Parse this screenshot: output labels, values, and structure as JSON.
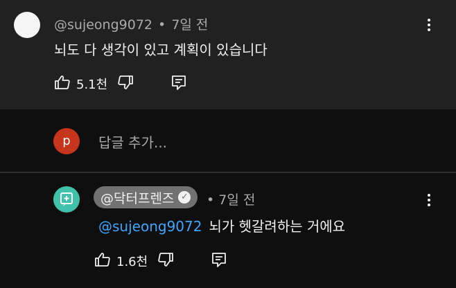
{
  "comment": {
    "author": "@sujeong9072",
    "separator": "•",
    "time": "7일 전",
    "text": "뇌도 다 생각이 있고 계획이 있습니다",
    "like_count": "5.1천"
  },
  "reply_box": {
    "avatar_letter": "p",
    "placeholder": "답글 추가..."
  },
  "reply": {
    "author": "@닥터프렌즈",
    "time": "7일 전",
    "mention": "@sujeong9072",
    "text": "뇌가 헷갈려하는 거에요",
    "like_count": "1.6천"
  },
  "colors": {
    "background": "#0f0f0f",
    "comment_highlight": "#212121",
    "mention": "#3ea6ff",
    "avatar_p": "#c6351c",
    "avatar_channel": "#3fc1aa"
  }
}
